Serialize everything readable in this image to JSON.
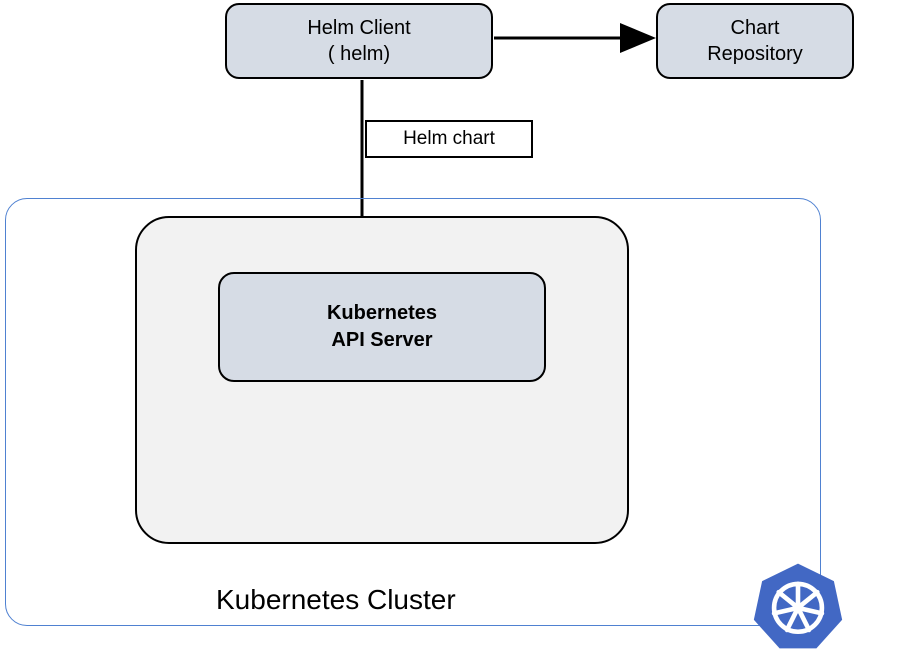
{
  "nodes": {
    "helm_client": {
      "line1": "Helm Client",
      "line2": "( helm)"
    },
    "chart_repo": {
      "line1": "Chart",
      "line2": "Repository"
    },
    "api_server": {
      "line1": "Kubernetes",
      "line2": "API Server"
    }
  },
  "edges": {
    "helm_chart_label": "Helm chart"
  },
  "cluster": {
    "title": "Kubernetes Cluster"
  }
}
